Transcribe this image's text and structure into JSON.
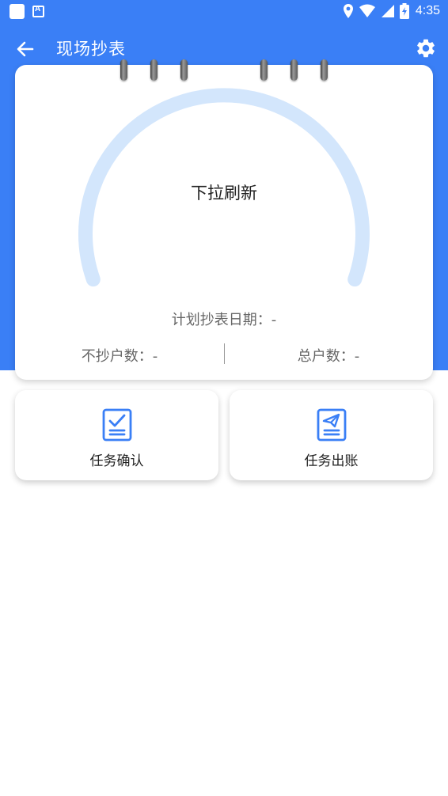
{
  "status_bar": {
    "time": "4:35",
    "icons": [
      "app-square-icon",
      "accessibility-a-icon",
      "location-icon",
      "wifi-icon",
      "signal-icon",
      "battery-charging-icon"
    ]
  },
  "app_bar": {
    "title": "现场抄表",
    "back_icon": "arrow-left-icon",
    "settings_icon": "gear-icon"
  },
  "colors": {
    "primary": "#3a7ff6",
    "gauge_track": "#d3e6fc",
    "icon_blue": "#3a7ff6"
  },
  "summary_card": {
    "center_text": "下拉刷新",
    "plan_date": "计划抄表日期：-",
    "unread_count": "不抄户数：-",
    "total_count": "总户数：-"
  },
  "actions": [
    {
      "label": "任务确认",
      "icon": "checklist-icon"
    },
    {
      "label": "任务出账",
      "icon": "send-document-icon"
    }
  ]
}
